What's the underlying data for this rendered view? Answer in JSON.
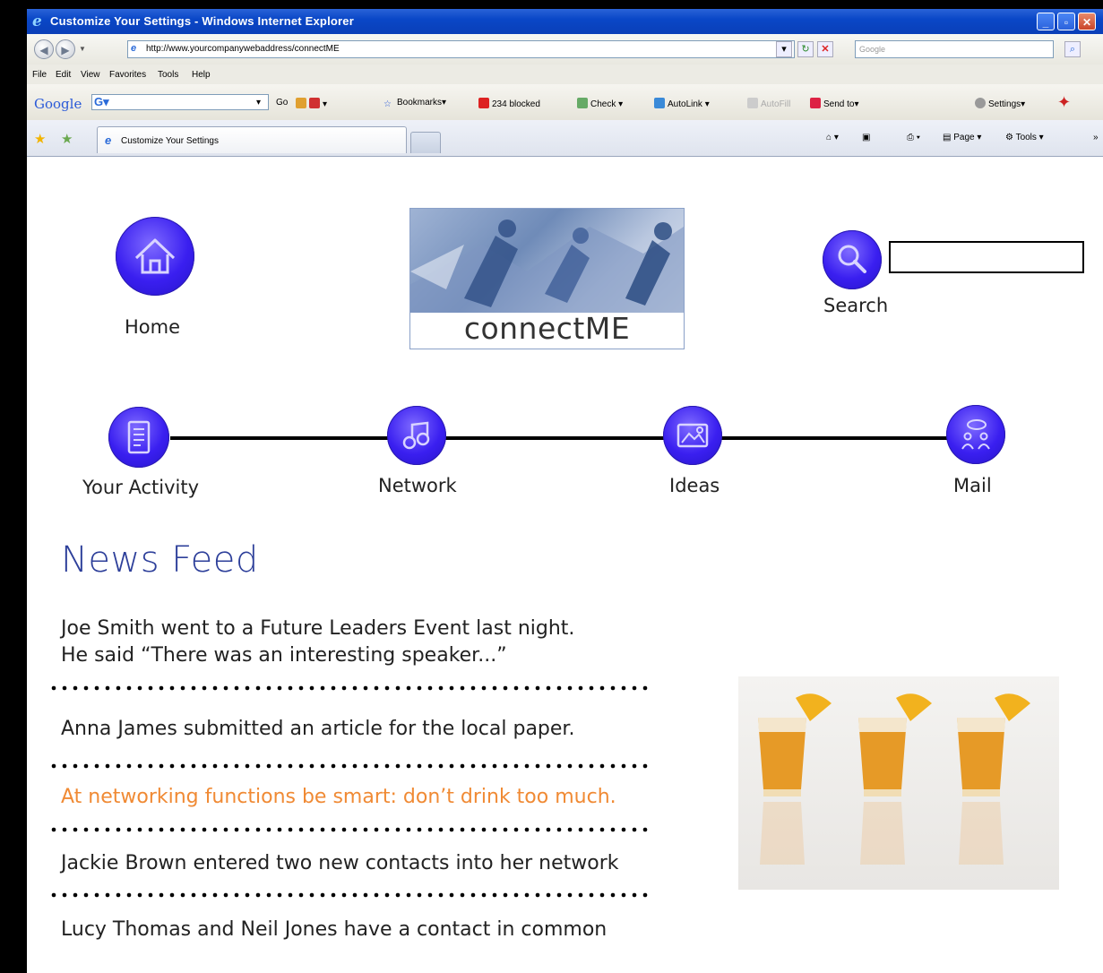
{
  "window": {
    "title": "Customize Your Settings - Windows Internet Explorer"
  },
  "addressbar": {
    "url": "http://www.yourcompanywebaddress/connectME",
    "search_placeholder": "Google"
  },
  "menu": [
    "File",
    "Edit",
    "View",
    "Favorites",
    "Tools",
    "Help"
  ],
  "google_toolbar": {
    "logo": "Google",
    "go_label": "Go",
    "bookmarks_label": "Bookmarks▾",
    "blocked_label": "234 blocked",
    "check_label": "Check ▾",
    "autolink_label": "AutoLink ▾",
    "autofill_label": "AutoFill",
    "sendto_label": "Send to▾",
    "settings_label": "Settings▾"
  },
  "tabs": {
    "active_tab": "Customize Your Settings",
    "page_label": "Page ▾",
    "tools_label": "Tools ▾"
  },
  "page": {
    "logo_text": "connectME",
    "nav": {
      "home": "Home",
      "search": "Search",
      "your_activity": "Your Activity",
      "network": "Network",
      "ideas": "Ideas",
      "mail": "Mail"
    },
    "news_heading": "News Feed",
    "feed": [
      {
        "line1": "Joe Smith went to a Future Leaders Event last night.",
        "line2": "He said “There was an interesting speaker...”"
      },
      {
        "line1": "Anna James submitted an article for the local paper."
      },
      {
        "line1": "At networking functions be smart: don’t drink too much."
      },
      {
        "line1": "Jackie Brown entered two new contacts into her network"
      },
      {
        "line1": "Lucy Thomas and Neil Jones have a contact in common"
      }
    ]
  },
  "colors": {
    "icon_blue": "#3a1ff0",
    "heading_blue": "#2d3f9a",
    "highlight_orange": "#f08a34",
    "titlebar_blue": "#0a47c7"
  }
}
